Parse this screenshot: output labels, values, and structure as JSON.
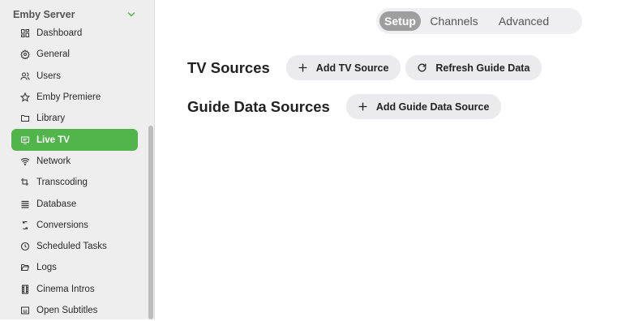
{
  "sidebar": {
    "section_title": "Emby Server",
    "items": [
      {
        "label": "Dashboard",
        "icon": "dashboard-icon"
      },
      {
        "label": "General",
        "icon": "settings-icon"
      },
      {
        "label": "Users",
        "icon": "users-icon"
      },
      {
        "label": "Emby Premiere",
        "icon": "star-icon"
      },
      {
        "label": "Library",
        "icon": "folder-icon"
      },
      {
        "label": "Live TV",
        "icon": "live-tv-icon",
        "active": true
      },
      {
        "label": "Network",
        "icon": "wifi-icon"
      },
      {
        "label": "Transcoding",
        "icon": "transcode-icon"
      },
      {
        "label": "Database",
        "icon": "database-icon"
      },
      {
        "label": "Conversions",
        "icon": "conversions-icon"
      },
      {
        "label": "Scheduled Tasks",
        "icon": "clock-icon"
      },
      {
        "label": "Logs",
        "icon": "folder-open-icon"
      },
      {
        "label": "Cinema Intros",
        "icon": "film-icon"
      },
      {
        "label": "Open Subtitles",
        "icon": "subtitles-icon"
      }
    ]
  },
  "tabs": [
    "Setup",
    "Channels",
    "Advanced"
  ],
  "tv_sources": {
    "title": "TV Sources",
    "add_label": "Add TV Source",
    "refresh_label": "Refresh Guide Data"
  },
  "guide_sources": {
    "title": "Guide Data Sources",
    "add_label": "Add Guide Data Source"
  },
  "colors": {
    "accent": "#52b54b",
    "tab_active": "#9e9e9e"
  }
}
